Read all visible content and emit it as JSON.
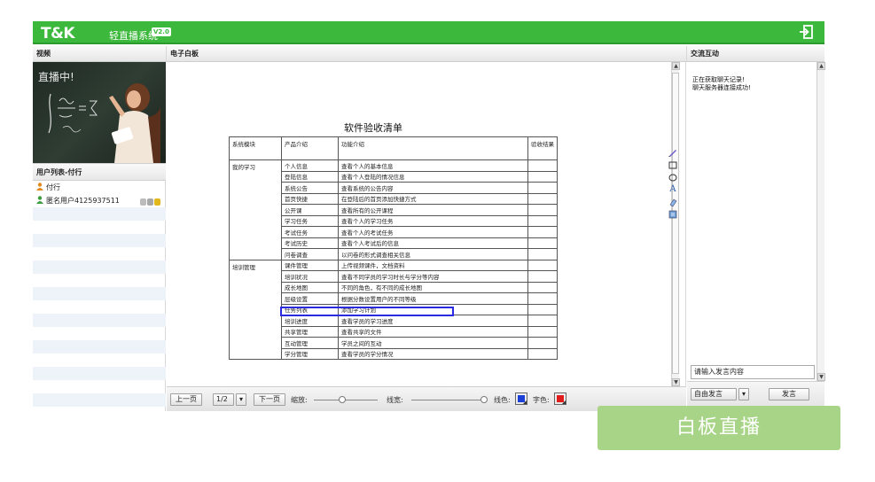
{
  "header": {
    "logo": "T&K",
    "app_name": "轻直播系统",
    "version_badge": "V2.0",
    "exit_icon": "exit-icon"
  },
  "columns": {
    "video": "视频",
    "whiteboard": "电子白板",
    "chat": "交流互动"
  },
  "video": {
    "overlay_text": "直播中!"
  },
  "user_list": {
    "title": "用户列表-付行",
    "users": [
      {
        "name": "付行",
        "icon": "teacher-icon"
      },
      {
        "name": "匿名用户4125937511",
        "icon": "user-icon"
      }
    ]
  },
  "whiteboard": {
    "doc_title": "软件验收清单",
    "table_header": [
      "系统模块",
      "产品介绍",
      "功能介绍",
      "验收结果"
    ],
    "groups": [
      {
        "module": "我的学习",
        "rows": [
          [
            "个人信息",
            "查看个人的基本信息"
          ],
          [
            "登陆信息",
            "查看个人登陆的情况信息"
          ],
          [
            "系统公告",
            "查看系统的公告内容"
          ],
          [
            "首页快捷",
            "在登陆后的首页添加快捷方式"
          ],
          [
            "公开课",
            "查看所有的公开课程"
          ],
          [
            "学习任务",
            "查看个人的学习任务"
          ],
          [
            "考试任务",
            "查看个人的考试任务"
          ],
          [
            "考试历史",
            "查看个人考试后的信息"
          ],
          [
            "问卷调查",
            "以问卷的形式调查相关信息"
          ]
        ]
      },
      {
        "module": "培训管理",
        "rows": [
          [
            "课件管理",
            "上传视频课件，文档资料"
          ],
          [
            "培训状况",
            "查看不同学员的学习时长与学分等内容"
          ],
          [
            "成长地图",
            "不同的角色，有不同的成长地图"
          ],
          [
            "层级设置",
            "根据分数设置用户的不同等级"
          ],
          [
            "任务列表",
            "添加学习计划"
          ],
          [
            "培训进度",
            "查看学员的学习进度"
          ],
          [
            "共享管理",
            "查看共享的文件"
          ],
          [
            "互动管理",
            "学员之间的互动"
          ],
          [
            "学分管理",
            "查看学员的学分情况"
          ]
        ]
      }
    ],
    "tools": [
      "pen-icon",
      "rect-icon",
      "ellipse-icon",
      "text-icon",
      "eraser-icon",
      "clear-icon"
    ],
    "toolbar": {
      "prev": "上一页",
      "page": "1/2",
      "next": "下一页",
      "zoom_label": "缩放:",
      "width_label": "线宽:",
      "line_color_label": "线色:",
      "font_color_label": "字色:",
      "line_color": "#1c3fd6",
      "font_color": "#e01c1c"
    }
  },
  "chat": {
    "messages": [
      "正在获取聊天记录!",
      "聊天服务器连接成功!"
    ],
    "input_placeholder": "请输入发言内容",
    "mode_select": "自由发言",
    "send": "发言"
  },
  "live_badge": "白板直播",
  "colors": {
    "brand": "#3cb83c",
    "badge": "#a7d486"
  }
}
